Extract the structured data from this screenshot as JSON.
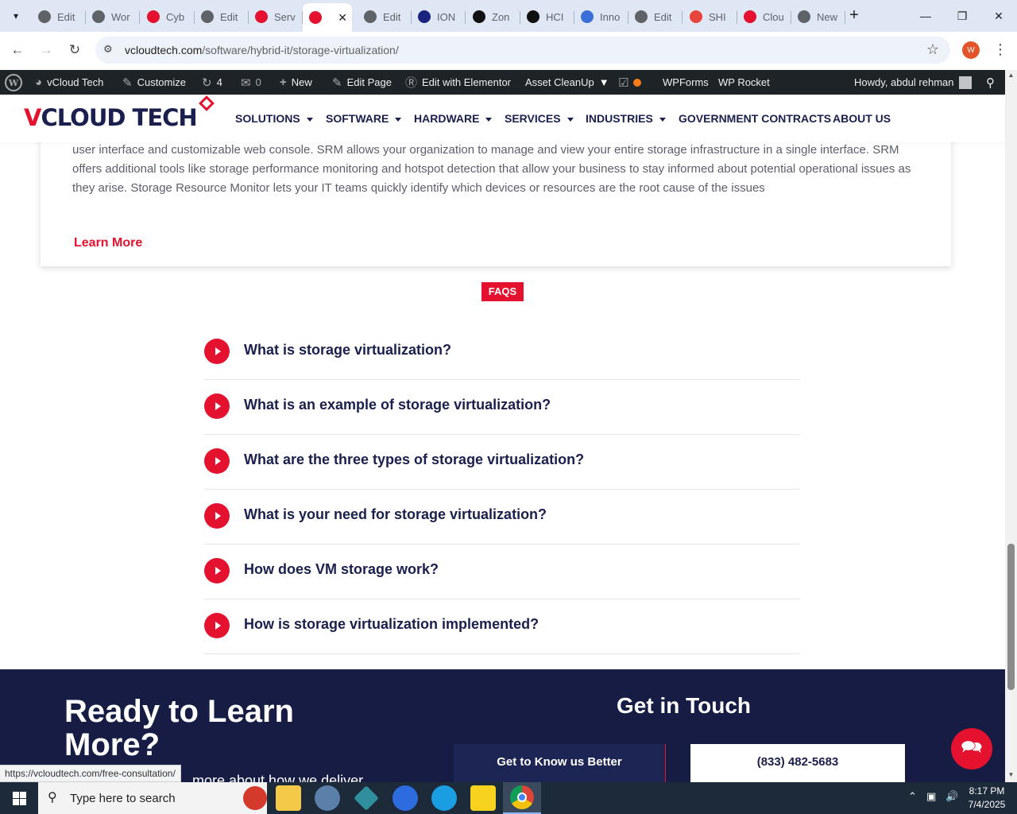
{
  "browser": {
    "tabs": [
      {
        "label": "Edit",
        "icon": "globe-icon",
        "color": "#5f6368"
      },
      {
        "label": "Wor",
        "icon": "globe-icon",
        "color": "#5f6368"
      },
      {
        "label": "Cyb",
        "icon": "vcloud-icon",
        "color": "#e4122e"
      },
      {
        "label": "Edit",
        "icon": "globe-icon",
        "color": "#5f6368"
      },
      {
        "label": "Serv",
        "icon": "vcloud-icon",
        "color": "#e4122e"
      },
      {
        "label": "",
        "icon": "vcloud-icon",
        "color": "#e4122e",
        "active": true
      },
      {
        "label": "Edit",
        "icon": "globe-icon",
        "color": "#5f6368"
      },
      {
        "label": "ION",
        "icon": "ion-icon",
        "color": "#1a237e"
      },
      {
        "label": "Zon",
        "icon": "z-icon",
        "color": "#111111"
      },
      {
        "label": "HCI",
        "icon": "openai-icon",
        "color": "#111111"
      },
      {
        "label": "Inno",
        "icon": "inno-icon",
        "color": "#3b6fd8"
      },
      {
        "label": "Edit",
        "icon": "globe-icon",
        "color": "#5f6368"
      },
      {
        "label": "SHI",
        "icon": "shi-icon",
        "color": "#e8453c"
      },
      {
        "label": "Clou",
        "icon": "cloud-icon",
        "color": "#e4122e"
      },
      {
        "label": "New",
        "icon": "chrome-icon",
        "color": "#5f6368"
      }
    ],
    "url_host": "vcloudtech.com",
    "url_path": "/software/hybrid-it/storage-virtualization/",
    "profile_initial": "W",
    "status_url": "https://vcloudtech.com/free-consultation/"
  },
  "adminbar": {
    "site": "vCloud Tech",
    "customize": "Customize",
    "updates": "4",
    "comments": "0",
    "new": "New",
    "edit_page": "Edit Page",
    "elementor": "Edit with Elementor",
    "cleanup": "Asset CleanUp",
    "wpforms": "WPForms",
    "wprocket": "WP Rocket",
    "howdy": "Howdy, abdul rehman"
  },
  "site": {
    "logo_text": "CLOUD TECH",
    "logo_v": "V",
    "nav": [
      {
        "label": "SOLUTIONS",
        "caret": true
      },
      {
        "label": "SOFTWARE",
        "caret": true
      },
      {
        "label": "HARDWARE",
        "caret": true
      },
      {
        "label": "SERVICES",
        "caret": true
      },
      {
        "label": "INDUSTRIES",
        "caret": true
      },
      {
        "label": "GOVERNMENT CONTRACTS",
        "caret": false
      },
      {
        "label": "ABOUT US",
        "caret": false
      }
    ]
  },
  "card": {
    "text": "user interface and customizable web console. SRM allows your organization to manage and view your entire storage infrastructure in a single interface. SRM offers additional tools like storage performance monitoring and hotspot detection that allow your business to stay informed about potential operational issues as they arise.  Storage Resource Monitor lets your IT teams quickly identify which devices or resources are the root cause of the issues",
    "learn_more": "Learn More"
  },
  "faqs": {
    "tag": "FAQS",
    "items": [
      "What is storage virtualization?",
      "What is an example of storage virtualization?",
      "What are the three types of storage virtualization?",
      "What is your need for storage virtualization?",
      "How does VM storage work?",
      "How is storage virtualization implemented?"
    ]
  },
  "footer": {
    "ready_title": "Ready to Learn More?",
    "ready_sub": "more about how we deliver",
    "get_in_touch": "Get in Touch",
    "know_button": "Get to Know us Better",
    "phone_button": "(833) 482-5683"
  },
  "taskbar": {
    "search_placeholder": "Type here to search",
    "time": "8:17 PM",
    "date": "7/4/2025"
  },
  "colors": {
    "accent": "#e4122e",
    "navy": "#1a1f4d",
    "footer_bg": "#161c44"
  }
}
